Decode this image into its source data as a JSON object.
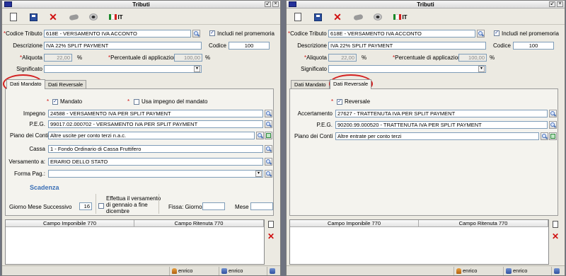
{
  "window_title": "Tributi",
  "lang_label": "IT",
  "codice_tributo": {
    "label": "Codice Tributo",
    "value": "618E - VERSAMENTO  IVA ACCONTO"
  },
  "includi": {
    "label": "Includi nel promemoria",
    "checked": true
  },
  "descrizione": {
    "label": "Descrizione",
    "value": "IVA 22% SPLIT PAYMENT"
  },
  "codice": {
    "label": "Codice",
    "value": "100"
  },
  "aliquota": {
    "label": "Aliquota",
    "value": "22,00",
    "unit": "%"
  },
  "percentuale": {
    "label": "Percentuale di applicazione",
    "value": "100,00",
    "unit": "%"
  },
  "significato": {
    "label": "Significato",
    "value": ""
  },
  "tabs": {
    "mandato": "Dati Mandato",
    "reversale": "Dati Reversale"
  },
  "left": {
    "mandato_label": "Mandato",
    "usa_impegno_label": "Usa impegno del mandato",
    "impegno": {
      "label": "Impegno",
      "value": "24588 - VERSAMENTO IVA PER SPLIT PAYMENT"
    },
    "peg": {
      "label": "P.E.G.",
      "value": "99017.02.000702 - VERSAMENTO IVA PER SPLIT PAYMENT"
    },
    "piano": {
      "label": "Piano dei Conti",
      "value": "Altre uscite per conto terzi n.a.c."
    },
    "cassa": {
      "label": "Cassa",
      "value": "1 - Fondo Ordinario di Cassa Fruttifero"
    },
    "versamento": {
      "label": "Versamento a:",
      "value": "ERARIO DELLO STATO"
    },
    "forma_pag": {
      "label": "Forma Pag.:",
      "value": ""
    },
    "scadenza_title": "Scadenza",
    "giorno_mese_label": "Giorno Mese Successivo",
    "giorno_mese_value": "16",
    "effettua_line1": "Effettua il versamento",
    "effettua_line2": "di gennaio a fine",
    "effettua_line3": "dicembre",
    "fissa_label": "Fissa: Giorno",
    "mese_label": "Mese",
    "col1": "Campo Imponibile 770",
    "col2": "Campo Ritenuta 770",
    "user": "enrico"
  },
  "right": {
    "reversale_label": "Reversale",
    "accertamento": {
      "label": "Accertamento",
      "value": "27627 - TRATTENUTA IVA PER SPLIT PAYMENT"
    },
    "peg": {
      "label": "P.E.G.",
      "value": "90200.99.000520 - TRATTENUTA IVA PER SPLIT PAYMENT"
    },
    "piano": {
      "label": "Piano dei Conti",
      "value": "Altre entrate per conto terzi"
    },
    "col1": "Campo Imponibile 770",
    "col2": "Campo Ritenuta 770",
    "user": "enrico"
  },
  "colors": {
    "accent": "#d42020",
    "section": "#3a6fb6"
  }
}
